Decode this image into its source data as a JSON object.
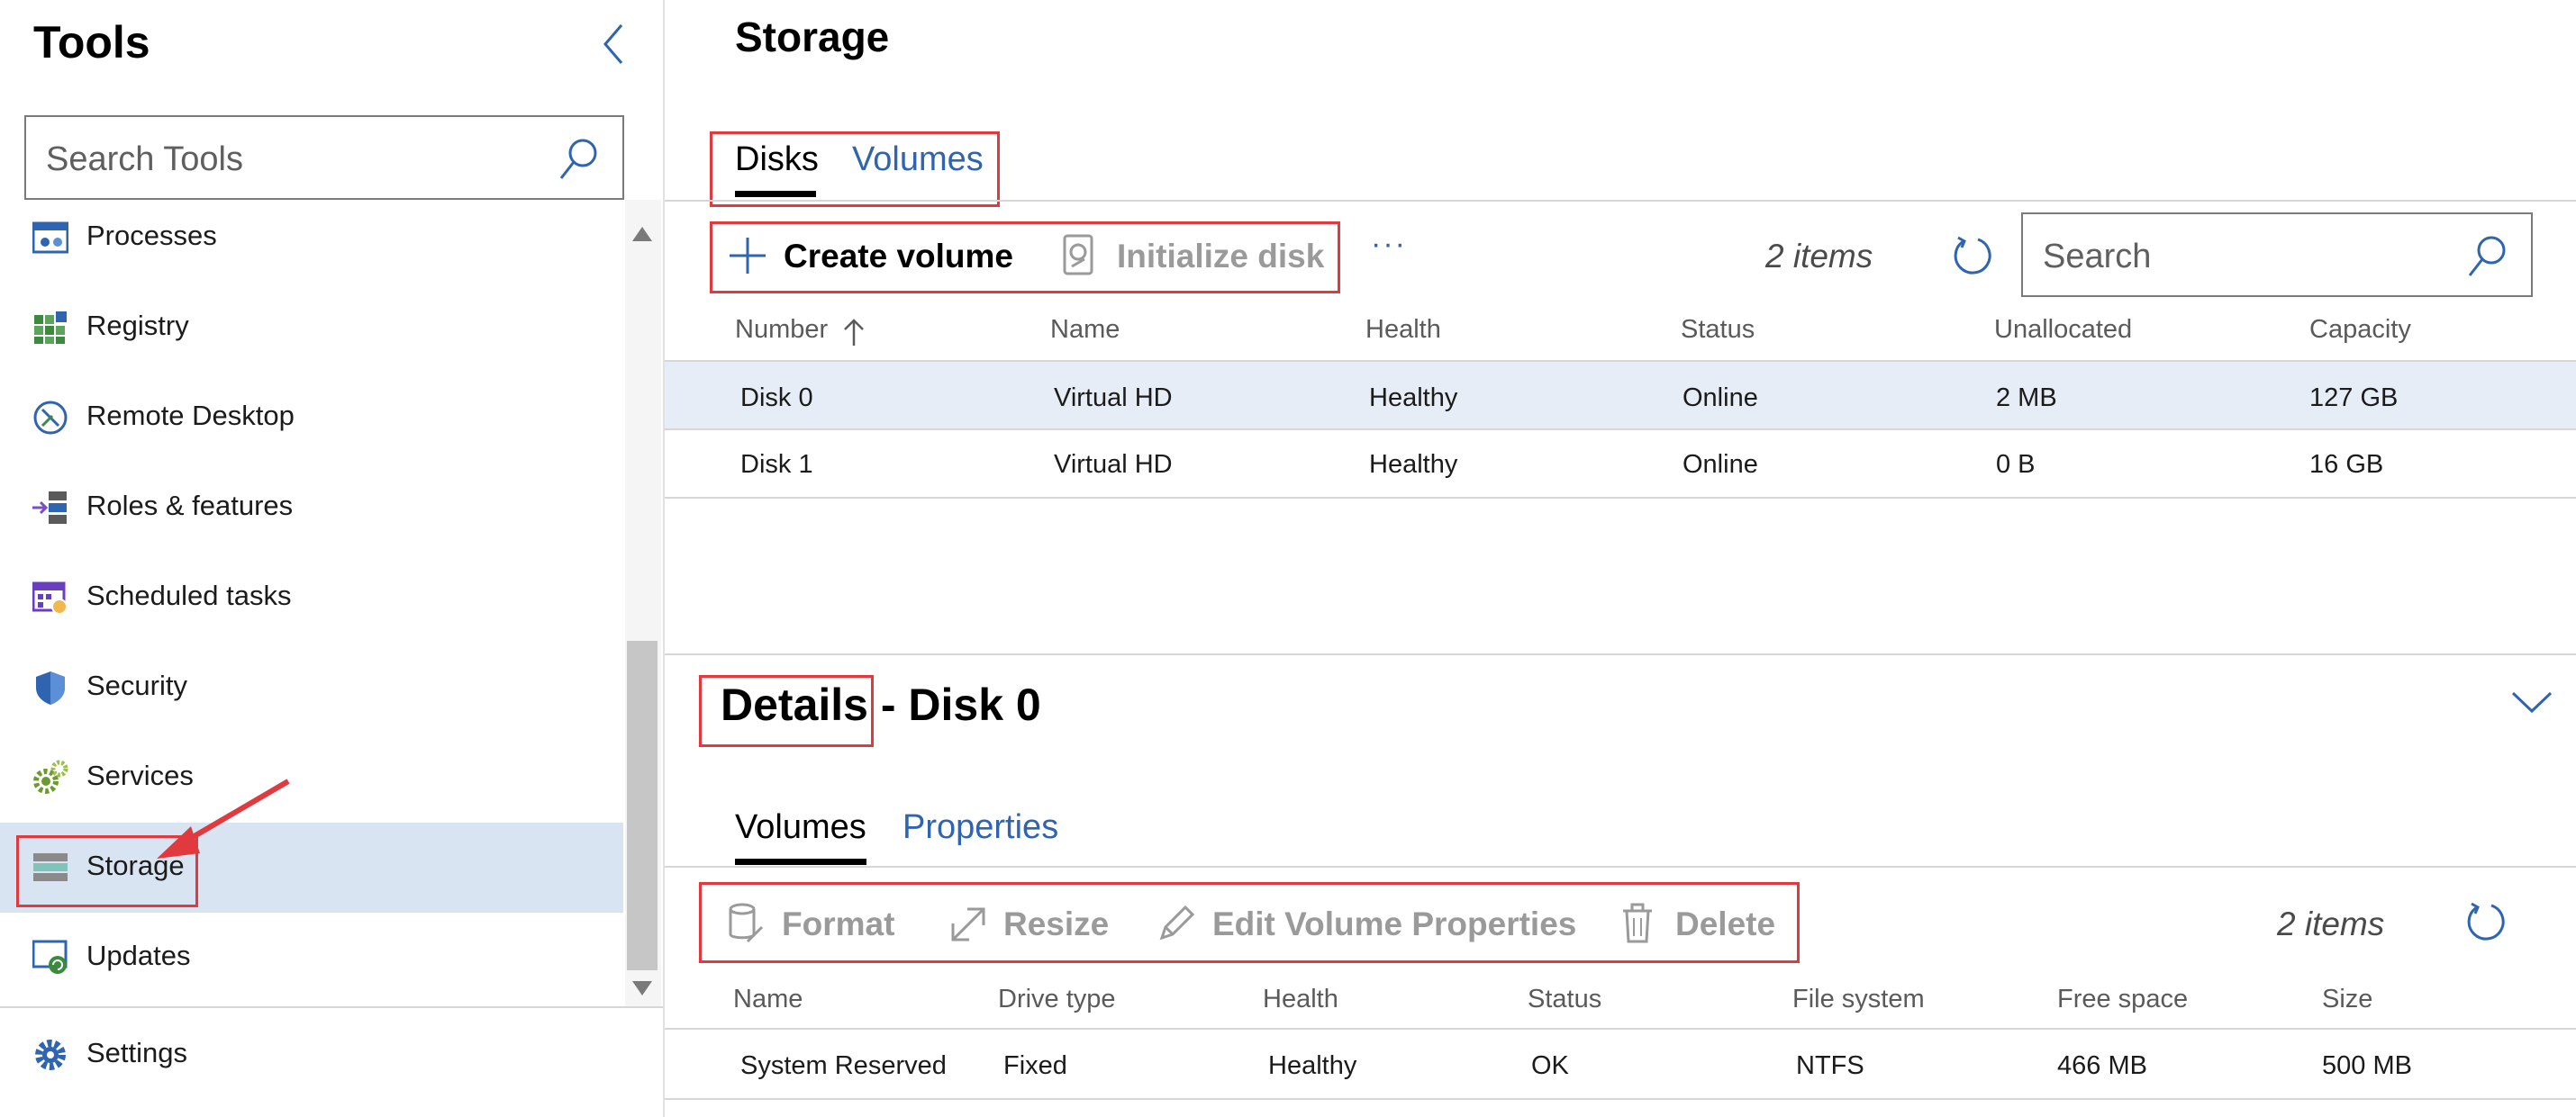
{
  "sidebar": {
    "title": "Tools",
    "search_placeholder": "Search Tools",
    "items": [
      {
        "label": "Processes",
        "icon": "processes-icon"
      },
      {
        "label": "Registry",
        "icon": "registry-icon"
      },
      {
        "label": "Remote Desktop",
        "icon": "remote-desktop-icon"
      },
      {
        "label": "Roles & features",
        "icon": "roles-features-icon"
      },
      {
        "label": "Scheduled tasks",
        "icon": "scheduled-tasks-icon"
      },
      {
        "label": "Security",
        "icon": "shield-icon"
      },
      {
        "label": "Services",
        "icon": "services-gear-icon"
      },
      {
        "label": "Storage",
        "icon": "storage-icon",
        "selected": true
      },
      {
        "label": "Updates",
        "icon": "updates-icon"
      }
    ],
    "settings_label": "Settings"
  },
  "main": {
    "title": "Storage",
    "tabs": [
      {
        "label": "Disks",
        "active": true
      },
      {
        "label": "Volumes",
        "active": false
      }
    ],
    "toolbar": {
      "create_volume": "Create volume",
      "initialize_disk": "Initialize disk",
      "more": "···",
      "count": "2 items",
      "search_placeholder": "Search"
    },
    "disks_table": {
      "columns": [
        "Number",
        "Name",
        "Health",
        "Status",
        "Unallocated",
        "Capacity"
      ],
      "rows": [
        [
          "Disk 0",
          "Virtual HD",
          "Healthy",
          "Online",
          "2 MB",
          "127 GB"
        ],
        [
          "Disk 1",
          "Virtual HD",
          "Healthy",
          "Online",
          "0 B",
          "16 GB"
        ]
      ]
    },
    "details": {
      "title": "Details",
      "subtitle": "- Disk 0",
      "tabs": [
        {
          "label": "Volumes",
          "active": true
        },
        {
          "label": "Properties",
          "active": false
        }
      ],
      "toolbar": {
        "format": "Format",
        "resize": "Resize",
        "edit_volume_properties": "Edit Volume Properties",
        "delete": "Delete",
        "count": "2 items"
      },
      "volumes_table": {
        "columns": [
          "Name",
          "Drive type",
          "Health",
          "Status",
          "File system",
          "Free space",
          "Size"
        ],
        "rows": [
          [
            "System Reserved",
            "Fixed",
            "Healthy",
            "OK",
            "NTFS",
            "466 MB",
            "500 MB"
          ]
        ]
      }
    }
  },
  "colors": {
    "accent": "#2f64b0",
    "selected_bg": "#d9e4f2",
    "highlight_border": "#e0393e"
  }
}
